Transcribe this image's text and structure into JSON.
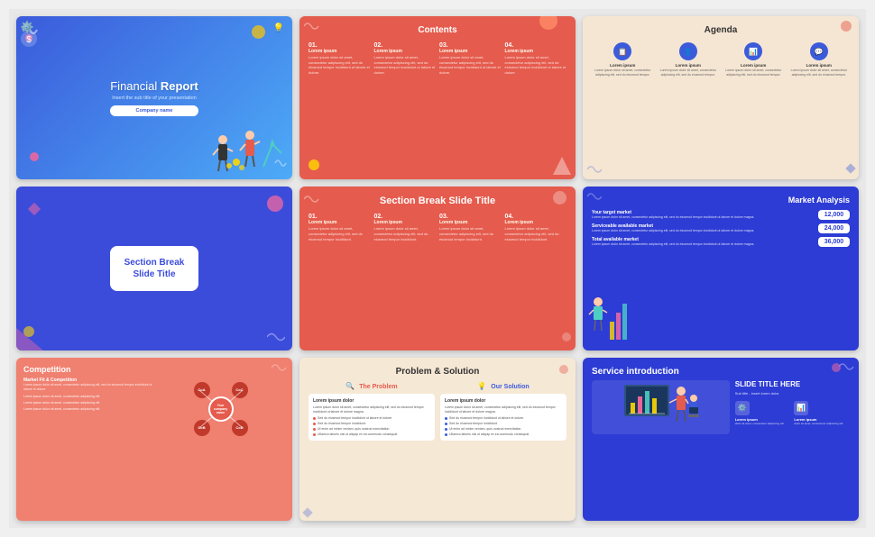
{
  "slides": [
    {
      "id": "slide-1",
      "type": "financial-report",
      "title_light": "Financial ",
      "title_bold": "Report",
      "subtitle": "Insert the sub title of your presentation",
      "company_btn": "Company name",
      "decorations": []
    },
    {
      "id": "slide-2",
      "type": "contents",
      "heading": "Contents",
      "items": [
        {
          "num": "01.",
          "label": "Lorem ipsum",
          "desc": "Lorem ipsum dolor sit amet, consectetur adipiscing elit, sed do eiusmod tempor incididunt ut labore et dolore."
        },
        {
          "num": "02.",
          "label": "Lorem ipsum",
          "desc": "Lorem ipsum dolor sit amet, consectetur adipiscing elit, sed do eiusmod tempor incididunt ut labore et dolore."
        },
        {
          "num": "03.",
          "label": "Lorem ipsum",
          "desc": "Lorem ipsum dolor sit amet, consectetur adipiscing elit, sed do eiusmod tempor incididunt ut labore et dolore."
        },
        {
          "num": "04.",
          "label": "Lorem ipsum",
          "desc": "Lorem ipsum dolor sit amet, consectetur adipiscing elit, sed do eiusmod tempor incididunt ut labore et dolore."
        }
      ]
    },
    {
      "id": "slide-3",
      "type": "agenda",
      "heading": "Agenda",
      "items": [
        {
          "icon": "📋",
          "label": "Lorem ipsum",
          "desc": "Lorem ipsum dolor sit amet, consectetur adipiscing elit, sed do eiusmod tempor."
        },
        {
          "icon": "👤",
          "label": "Lorem ipsum",
          "desc": "Lorem ipsum dolor sit amet, consectetur adipiscing elit, sed do eiusmod tempor."
        },
        {
          "icon": "📊",
          "label": "Lorem ipsum",
          "desc": "Lorem ipsum dolor sit amet, consectetur adipiscing elit, sed do eiusmod tempor."
        },
        {
          "icon": "💬",
          "label": "Lorem ipsum",
          "desc": "Lorem ipsum dolor sit amet, consectetur adipiscing elit, sed do eiusmod tempor."
        }
      ]
    },
    {
      "id": "slide-4",
      "type": "section-break-blue",
      "title": "Section Break\nSlide Title"
    },
    {
      "id": "slide-5",
      "type": "section-break-red",
      "heading": "Section Break Slide Title",
      "items": [
        {
          "num": "01.",
          "label": "Lorem ipsum",
          "desc": "Lorem ipsum dolor sit amet, consectetur adipiscing elit, sed do eiusmod tempor incididunt."
        },
        {
          "num": "02.",
          "label": "Lorem ipsum",
          "desc": "Lorem ipsum dolor sit amet, consectetur adipiscing elit, sed do eiusmod tempor incididunt."
        },
        {
          "num": "03.",
          "label": "Lorem ipsum",
          "desc": "Lorem ipsum dolor sit amet, consectetur adipiscing elit, sed do eiusmod tempor incididunt."
        },
        {
          "num": "04.",
          "label": "Lorem ipsum",
          "desc": "Lorem ipsum dolor sit amet, consectetur adipiscing elit, sed do eiusmod tempor incididunt."
        }
      ]
    },
    {
      "id": "slide-6",
      "type": "market-analysis",
      "heading": "Market Analysis",
      "items": [
        {
          "value": "12,000",
          "title": "Your target market",
          "desc": "Lorem ipsum dolor sit amet, consectetur adipiscing elit, sed do eiusmod tempor incididunt ut labore et dolore magna."
        },
        {
          "value": "24,000",
          "title": "Serviceable available market",
          "desc": "Lorem ipsum dolor sit amet, consectetur adipiscing elit, sed do eiusmod tempor incididunt ut labore et dolore magna."
        },
        {
          "value": "36,000",
          "title": "Total available market",
          "desc": "Lorem ipsum dolor sit amet, consectetur adipiscing elit, sed do eiusmod tempor incididunt ut labore et dolore magna."
        }
      ]
    },
    {
      "id": "slide-7",
      "type": "competition",
      "heading": "Competition",
      "sub_heading": "Market Fit & Competition",
      "desc": "Lorem ipsum dolor sit amet, consectetur adipiscing elit, sed do eiusmod tempor incididunt ut labore et dolore.",
      "items": [
        {
          "label": "Lorem ipsum dolor sit amet, consectetur adipiscing elit."
        },
        {
          "label": "Lorem ipsum dolor sit amet, consectetur adipiscing elit."
        },
        {
          "label": "Lorem ipsum dolor sit amet, consectetur adipiscing elit."
        }
      ],
      "nodes": [
        "CoA",
        "CoB",
        "CoC",
        "CoD",
        "Your company name"
      ]
    },
    {
      "id": "slide-8",
      "type": "problem-solution",
      "heading": "Problem & Solution",
      "problem_title": "The Problem",
      "solution_title": "Our Solution",
      "problem_main": "Lorem ipsum dolor",
      "problem_body": "Lorem ipsum dolor sit amet, consectetur adipiscing elit, sed do eiusmod tempor incididunt ut labore et dolore magna.",
      "problem_bullets": [
        "Sed do eiusmod tempor incididunt ut labore et dolore.",
        "Sed do eiusmod tempor incididunt.",
        "Ut enim ad minim veniam, quis nostrud exercitation.",
        "Ullamco laboris nisi ut aliquip ex ea commodo consequat."
      ],
      "solution_main": "Lorem ipsum dolor",
      "solution_body": "Lorem ipsum dolor sit amet, consectetur adipiscing elit, sed do eiusmod tempor incididunt ut labore et dolore magna.",
      "solution_bullets": [
        "Sed do eiusmod tempor incididunt ut labore et dolore.",
        "Sed do eiusmod tempor incididunt.",
        "Ut enim ad minim veniam, quis nostrud exercitation.",
        "Ullamco laboris nisi ut aliquip ex ea commodo consequat."
      ]
    },
    {
      "id": "slide-9",
      "type": "service-introduction",
      "heading": "Service introduction",
      "big_title": "SLIDE TITLE HERE",
      "sub_title": "Sub title - insert lorem dolor",
      "icons": [
        {
          "icon": "⚙️",
          "label": "Lorem ipsum",
          "desc": "dolor sit amet, consectetur adipiscing elit."
        },
        {
          "icon": "📊",
          "label": "Lorem ipsum",
          "desc": "dolor sit amet, consectetur adipiscing elit."
        }
      ]
    }
  ]
}
